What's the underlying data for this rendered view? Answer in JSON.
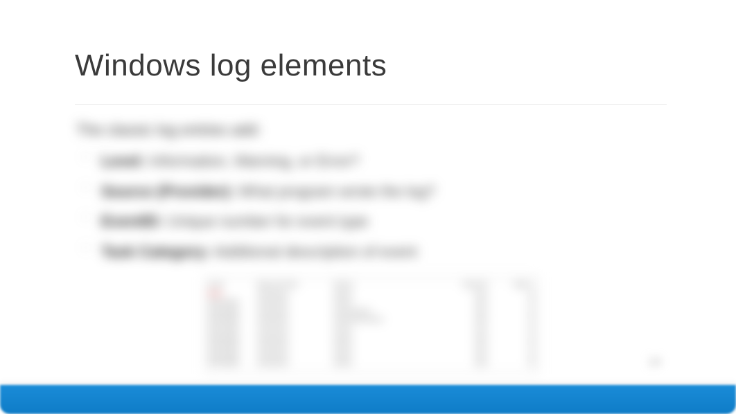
{
  "title": "Windows log elements",
  "lead": "The classic log entries add:",
  "bullets": [
    {
      "term": "Level:",
      "desc": " Information, Warning, or Error?"
    },
    {
      "term": "Source (Provider):",
      "desc": " What program wrote the log?"
    },
    {
      "term": "EventID:",
      "desc": " Unique number for event type"
    },
    {
      "term": "Task Category:",
      "desc": " Additional description of event"
    }
  ],
  "table_rows": [
    {
      "c1": "Level",
      "c1red": false,
      "c2": "Date and Time",
      "c3": "Source",
      "c4": "Event ID",
      "c5": "Task C."
    },
    {
      "c1": "Error",
      "c1red": true,
      "c2": "xxxxxxxxxx",
      "c3": "xxxxxx",
      "c4": "xxxx",
      "c5": "xx"
    },
    {
      "c1": "Information",
      "c1red": false,
      "c2": "xxxxxxxxxx",
      "c3": "xxxxxx",
      "c4": "xxxx",
      "c5": "xx"
    },
    {
      "c1": "Information",
      "c1red": false,
      "c2": "xxxxxxxxxx",
      "c3": "xxxxxxxxxxxx",
      "c4": "xxxx",
      "c5": "xx"
    },
    {
      "c1": "Information",
      "c1red": false,
      "c2": "xxxxxxxxxx",
      "c3": "xxxxxxxxxxxxxxxx",
      "c4": "xxxx",
      "c5": "xx"
    },
    {
      "c1": "Information",
      "c1red": false,
      "c2": "xxxxxxxxxx",
      "c3": "xxxxxx",
      "c4": "xxxx",
      "c5": "xx"
    },
    {
      "c1": "Information",
      "c1red": false,
      "c2": "xxxxxxxxxx",
      "c3": "xxxxxx",
      "c4": "xxxx",
      "c5": "xx"
    },
    {
      "c1": "Information",
      "c1red": false,
      "c2": "xxxxxxxxxx",
      "c3": "xxxxxx",
      "c4": "xxxx",
      "c5": "xx"
    },
    {
      "c1": "Information",
      "c1red": false,
      "c2": "xxxxxxxxxx",
      "c3": "xxxxxx",
      "c4": "xxxx",
      "c5": "xx"
    },
    {
      "c1": "Information",
      "c1red": false,
      "c2": "xxxxxxxxxx",
      "c3": "xxxxxx",
      "c4": "xxxx",
      "c5": "xx"
    }
  ],
  "page_corner": "19"
}
